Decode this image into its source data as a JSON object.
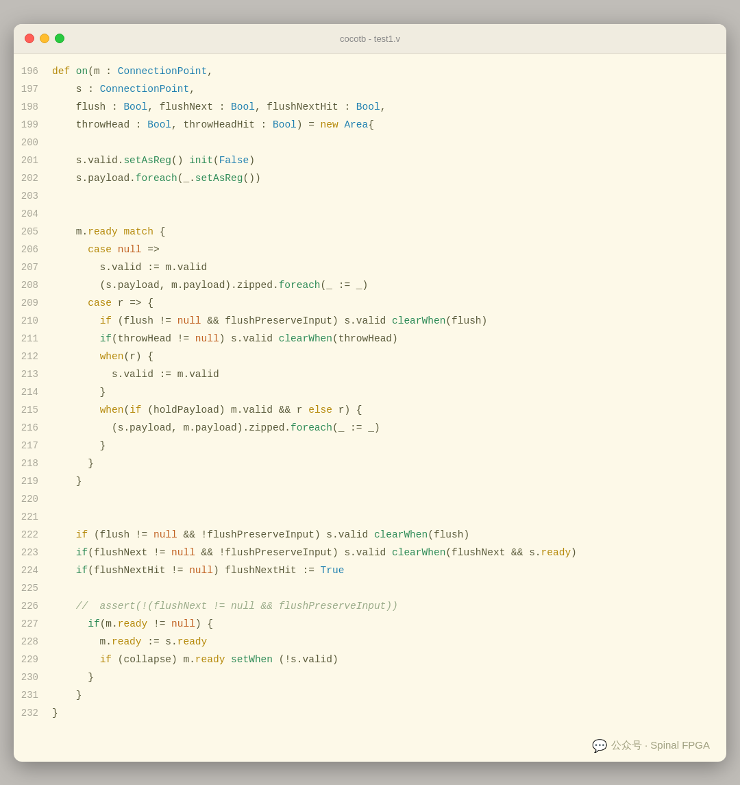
{
  "window": {
    "title": "cocotb - test1.v",
    "traffic_lights": [
      "close",
      "minimize",
      "maximize"
    ]
  },
  "lines": [
    {
      "num": "196",
      "tokens": [
        {
          "t": "kw",
          "v": "def "
        },
        {
          "t": "fn",
          "v": "on"
        },
        {
          "t": "sym",
          "v": "("
        },
        {
          "t": "sym",
          "v": "m "
        },
        {
          "t": "sym",
          "v": ": "
        },
        {
          "t": "type",
          "v": "ConnectionPoint"
        },
        {
          "t": "sym",
          "v": ","
        }
      ]
    },
    {
      "num": "197",
      "tokens": [
        {
          "t": "sym",
          "v": "    s : "
        },
        {
          "t": "type",
          "v": "ConnectionPoint"
        },
        {
          "t": "sym",
          "v": ","
        }
      ]
    },
    {
      "num": "198",
      "tokens": [
        {
          "t": "sym",
          "v": "    flush : "
        },
        {
          "t": "type",
          "v": "Bool"
        },
        {
          "t": "sym",
          "v": ", flushNext : "
        },
        {
          "t": "type",
          "v": "Bool"
        },
        {
          "t": "sym",
          "v": ", flushNextHit : "
        },
        {
          "t": "type",
          "v": "Bool"
        },
        {
          "t": "sym",
          "v": ","
        }
      ]
    },
    {
      "num": "199",
      "tokens": [
        {
          "t": "sym",
          "v": "    throwHead : "
        },
        {
          "t": "type",
          "v": "Bool"
        },
        {
          "t": "sym",
          "v": ", throwHeadHit : "
        },
        {
          "t": "type",
          "v": "Bool"
        },
        {
          "t": "sym",
          "v": ") = "
        },
        {
          "t": "kw",
          "v": "new "
        },
        {
          "t": "type",
          "v": "Area"
        },
        {
          "t": "sym",
          "v": "{"
        }
      ]
    },
    {
      "num": "200",
      "tokens": []
    },
    {
      "num": "201",
      "tokens": [
        {
          "t": "sym",
          "v": "    s.valid."
        },
        {
          "t": "fn",
          "v": "setAsReg"
        },
        {
          "t": "sym",
          "v": "() "
        },
        {
          "t": "fn",
          "v": "init"
        },
        {
          "t": "sym",
          "v": "("
        },
        {
          "t": "type",
          "v": "False"
        },
        {
          "t": "sym",
          "v": ")"
        }
      ]
    },
    {
      "num": "202",
      "tokens": [
        {
          "t": "sym",
          "v": "    s.payload."
        },
        {
          "t": "fn",
          "v": "foreach"
        },
        {
          "t": "sym",
          "v": "(_."
        },
        {
          "t": "fn",
          "v": "setAsReg"
        },
        {
          "t": "sym",
          "v": "())"
        }
      ]
    },
    {
      "num": "203",
      "tokens": []
    },
    {
      "num": "204",
      "tokens": []
    },
    {
      "num": "205",
      "tokens": [
        {
          "t": "sym",
          "v": "    m."
        },
        {
          "t": "kw",
          "v": "ready match "
        },
        {
          "t": "sym",
          "v": "{"
        }
      ]
    },
    {
      "num": "206",
      "tokens": [
        {
          "t": "sym",
          "v": "      "
        },
        {
          "t": "kw",
          "v": "case "
        },
        {
          "t": "lit",
          "v": "null "
        },
        {
          "t": "sym",
          "v": "=>"
        }
      ]
    },
    {
      "num": "207",
      "tokens": [
        {
          "t": "sym",
          "v": "        s.valid := m.valid"
        }
      ]
    },
    {
      "num": "208",
      "tokens": [
        {
          "t": "sym",
          "v": "        (s.payload, m.payload).zipped."
        },
        {
          "t": "fn",
          "v": "foreach"
        },
        {
          "t": "sym",
          "v": "(_ := _)"
        }
      ]
    },
    {
      "num": "209",
      "tokens": [
        {
          "t": "sym",
          "v": "      "
        },
        {
          "t": "kw",
          "v": "case "
        },
        {
          "t": "sym",
          "v": "r => {"
        }
      ]
    },
    {
      "num": "210",
      "tokens": [
        {
          "t": "sym",
          "v": "        "
        },
        {
          "t": "kw",
          "v": "if "
        },
        {
          "t": "sym",
          "v": "(flush != "
        },
        {
          "t": "lit",
          "v": "null "
        },
        {
          "t": "sym",
          "v": "&& flushPreserveInput) s.valid "
        },
        {
          "t": "fn",
          "v": "clearWhen"
        },
        {
          "t": "sym",
          "v": "(flush)"
        }
      ]
    },
    {
      "num": "211",
      "tokens": [
        {
          "t": "sym",
          "v": "        "
        },
        {
          "t": "fn",
          "v": "if"
        },
        {
          "t": "sym",
          "v": "(throwHead != "
        },
        {
          "t": "lit",
          "v": "null"
        },
        {
          "t": "sym",
          "v": ") s.valid "
        },
        {
          "t": "fn",
          "v": "clearWhen"
        },
        {
          "t": "sym",
          "v": "(throwHead)"
        }
      ]
    },
    {
      "num": "212",
      "tokens": [
        {
          "t": "sym",
          "v": "        "
        },
        {
          "t": "kw",
          "v": "when"
        },
        {
          "t": "sym",
          "v": "(r) {"
        }
      ]
    },
    {
      "num": "213",
      "tokens": [
        {
          "t": "sym",
          "v": "          s.valid := m.valid"
        }
      ]
    },
    {
      "num": "214",
      "tokens": [
        {
          "t": "sym",
          "v": "        }"
        }
      ]
    },
    {
      "num": "215",
      "tokens": [
        {
          "t": "sym",
          "v": "        "
        },
        {
          "t": "kw",
          "v": "when"
        },
        {
          "t": "sym",
          "v": "("
        },
        {
          "t": "kw",
          "v": "if "
        },
        {
          "t": "sym",
          "v": "(holdPayload) m.valid && r "
        },
        {
          "t": "kw",
          "v": "else "
        },
        {
          "t": "sym",
          "v": "r) {"
        }
      ]
    },
    {
      "num": "216",
      "tokens": [
        {
          "t": "sym",
          "v": "          (s.payload, m.payload).zipped."
        },
        {
          "t": "fn",
          "v": "foreach"
        },
        {
          "t": "sym",
          "v": "(_ := _)"
        }
      ]
    },
    {
      "num": "217",
      "tokens": [
        {
          "t": "sym",
          "v": "        }"
        }
      ]
    },
    {
      "num": "218",
      "tokens": [
        {
          "t": "sym",
          "v": "      }"
        }
      ]
    },
    {
      "num": "219",
      "tokens": [
        {
          "t": "sym",
          "v": "    }"
        }
      ]
    },
    {
      "num": "220",
      "tokens": []
    },
    {
      "num": "221",
      "tokens": []
    },
    {
      "num": "222",
      "tokens": [
        {
          "t": "sym",
          "v": "    "
        },
        {
          "t": "kw",
          "v": "if "
        },
        {
          "t": "sym",
          "v": "(flush != "
        },
        {
          "t": "lit",
          "v": "null "
        },
        {
          "t": "sym",
          "v": "&& !flushPreserveInput) s.valid "
        },
        {
          "t": "fn",
          "v": "clearWhen"
        },
        {
          "t": "sym",
          "v": "(flush)"
        }
      ]
    },
    {
      "num": "223",
      "tokens": [
        {
          "t": "sym",
          "v": "    "
        },
        {
          "t": "fn",
          "v": "if"
        },
        {
          "t": "sym",
          "v": "(flushNext != "
        },
        {
          "t": "lit",
          "v": "null "
        },
        {
          "t": "sym",
          "v": "&& !flushPreserveInput) s.valid "
        },
        {
          "t": "fn",
          "v": "clearWhen"
        },
        {
          "t": "sym",
          "v": "(flushNext && s."
        },
        {
          "t": "kw",
          "v": "ready"
        },
        {
          "t": "sym",
          "v": ")"
        }
      ]
    },
    {
      "num": "224",
      "tokens": [
        {
          "t": "sym",
          "v": "    "
        },
        {
          "t": "fn",
          "v": "if"
        },
        {
          "t": "sym",
          "v": "(flushNextHit != "
        },
        {
          "t": "lit",
          "v": "null"
        },
        {
          "t": "sym",
          "v": ") flushNextHit := "
        },
        {
          "t": "type",
          "v": "True"
        }
      ]
    },
    {
      "num": "225",
      "tokens": []
    },
    {
      "num": "226",
      "tokens": [
        {
          "t": "cm",
          "v": "    //  assert(!(flushNext != null && flushPreserveInput))"
        }
      ]
    },
    {
      "num": "227",
      "tokens": [
        {
          "t": "sym",
          "v": "      "
        },
        {
          "t": "fn",
          "v": "if"
        },
        {
          "t": "sym",
          "v": "(m."
        },
        {
          "t": "kw",
          "v": "ready "
        },
        {
          "t": "sym",
          "v": "!= "
        },
        {
          "t": "lit",
          "v": "null"
        },
        {
          "t": "sym",
          "v": ") {"
        }
      ]
    },
    {
      "num": "228",
      "tokens": [
        {
          "t": "sym",
          "v": "        m."
        },
        {
          "t": "kw",
          "v": "ready "
        },
        {
          "t": "sym",
          "v": ":= s."
        },
        {
          "t": "kw",
          "v": "ready"
        }
      ]
    },
    {
      "num": "229",
      "tokens": [
        {
          "t": "sym",
          "v": "        "
        },
        {
          "t": "kw",
          "v": "if "
        },
        {
          "t": "sym",
          "v": "(collapse) m."
        },
        {
          "t": "kw",
          "v": "ready "
        },
        {
          "t": "fn",
          "v": "setWhen "
        },
        {
          "t": "sym",
          "v": "(!s.valid)"
        }
      ]
    },
    {
      "num": "230",
      "tokens": [
        {
          "t": "sym",
          "v": "      }"
        }
      ]
    },
    {
      "num": "231",
      "tokens": [
        {
          "t": "sym",
          "v": "    }"
        }
      ]
    },
    {
      "num": "232",
      "tokens": [
        {
          "t": "sym",
          "v": "}"
        }
      ]
    }
  ],
  "watermark": {
    "icon": "💬",
    "text": "公众号 · Spinal FPGA"
  }
}
